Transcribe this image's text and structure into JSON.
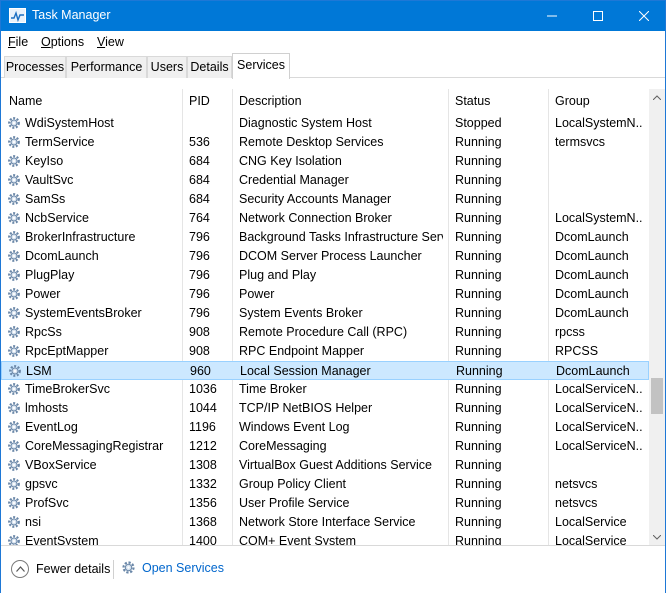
{
  "window": {
    "title": "Task Manager"
  },
  "menu": [
    {
      "underline": "F",
      "rest": "ile"
    },
    {
      "underline": "O",
      "rest": "ptions"
    },
    {
      "underline": "V",
      "rest": "iew"
    }
  ],
  "tabs": [
    "Processes",
    "Performance",
    "Users",
    "Details",
    "Services"
  ],
  "active_tab": "Services",
  "columns": {
    "name": "Name",
    "pid": "PID",
    "description": "Description",
    "status": "Status",
    "group": "Group"
  },
  "services": [
    {
      "name": "WdiSystemHost",
      "pid": "",
      "description": "Diagnostic System Host",
      "status": "Stopped",
      "group": "LocalSystemN..."
    },
    {
      "name": "TermService",
      "pid": "536",
      "description": "Remote Desktop Services",
      "status": "Running",
      "group": "termsvcs"
    },
    {
      "name": "KeyIso",
      "pid": "684",
      "description": "CNG Key Isolation",
      "status": "Running",
      "group": ""
    },
    {
      "name": "VaultSvc",
      "pid": "684",
      "description": "Credential Manager",
      "status": "Running",
      "group": ""
    },
    {
      "name": "SamSs",
      "pid": "684",
      "description": "Security Accounts Manager",
      "status": "Running",
      "group": ""
    },
    {
      "name": "NcbService",
      "pid": "764",
      "description": "Network Connection Broker",
      "status": "Running",
      "group": "LocalSystemN..."
    },
    {
      "name": "BrokerInfrastructure",
      "pid": "796",
      "description": "Background Tasks Infrastructure Serv...",
      "status": "Running",
      "group": "DcomLaunch"
    },
    {
      "name": "DcomLaunch",
      "pid": "796",
      "description": "DCOM Server Process Launcher",
      "status": "Running",
      "group": "DcomLaunch"
    },
    {
      "name": "PlugPlay",
      "pid": "796",
      "description": "Plug and Play",
      "status": "Running",
      "group": "DcomLaunch"
    },
    {
      "name": "Power",
      "pid": "796",
      "description": "Power",
      "status": "Running",
      "group": "DcomLaunch"
    },
    {
      "name": "SystemEventsBroker",
      "pid": "796",
      "description": "System Events Broker",
      "status": "Running",
      "group": "DcomLaunch"
    },
    {
      "name": "RpcSs",
      "pid": "908",
      "description": "Remote Procedure Call (RPC)",
      "status": "Running",
      "group": "rpcss"
    },
    {
      "name": "RpcEptMapper",
      "pid": "908",
      "description": "RPC Endpoint Mapper",
      "status": "Running",
      "group": "RPCSS"
    },
    {
      "name": "LSM",
      "pid": "960",
      "description": "Local Session Manager",
      "status": "Running",
      "group": "DcomLaunch",
      "selected": true
    },
    {
      "name": "TimeBrokerSvc",
      "pid": "1036",
      "description": "Time Broker",
      "status": "Running",
      "group": "LocalServiceN..."
    },
    {
      "name": "lmhosts",
      "pid": "1044",
      "description": "TCP/IP NetBIOS Helper",
      "status": "Running",
      "group": "LocalServiceN..."
    },
    {
      "name": "EventLog",
      "pid": "1196",
      "description": "Windows Event Log",
      "status": "Running",
      "group": "LocalServiceN..."
    },
    {
      "name": "CoreMessagingRegistrar",
      "pid": "1212",
      "description": "CoreMessaging",
      "status": "Running",
      "group": "LocalServiceN..."
    },
    {
      "name": "VBoxService",
      "pid": "1308",
      "description": "VirtualBox Guest Additions Service",
      "status": "Running",
      "group": ""
    },
    {
      "name": "gpsvc",
      "pid": "1332",
      "description": "Group Policy Client",
      "status": "Running",
      "group": "netsvcs"
    },
    {
      "name": "ProfSvc",
      "pid": "1356",
      "description": "User Profile Service",
      "status": "Running",
      "group": "netsvcs"
    },
    {
      "name": "nsi",
      "pid": "1368",
      "description": "Network Store Interface Service",
      "status": "Running",
      "group": "LocalService"
    },
    {
      "name": "EventSystem",
      "pid": "1400",
      "description": "COM+ Event System",
      "status": "Running",
      "group": "LocalService"
    }
  ],
  "footer": {
    "fewer_details": "Fewer details",
    "open_services": "Open Services"
  },
  "colors": {
    "titlebar": "#0078d7",
    "selection": "#cce8ff",
    "link": "#0066cc"
  }
}
